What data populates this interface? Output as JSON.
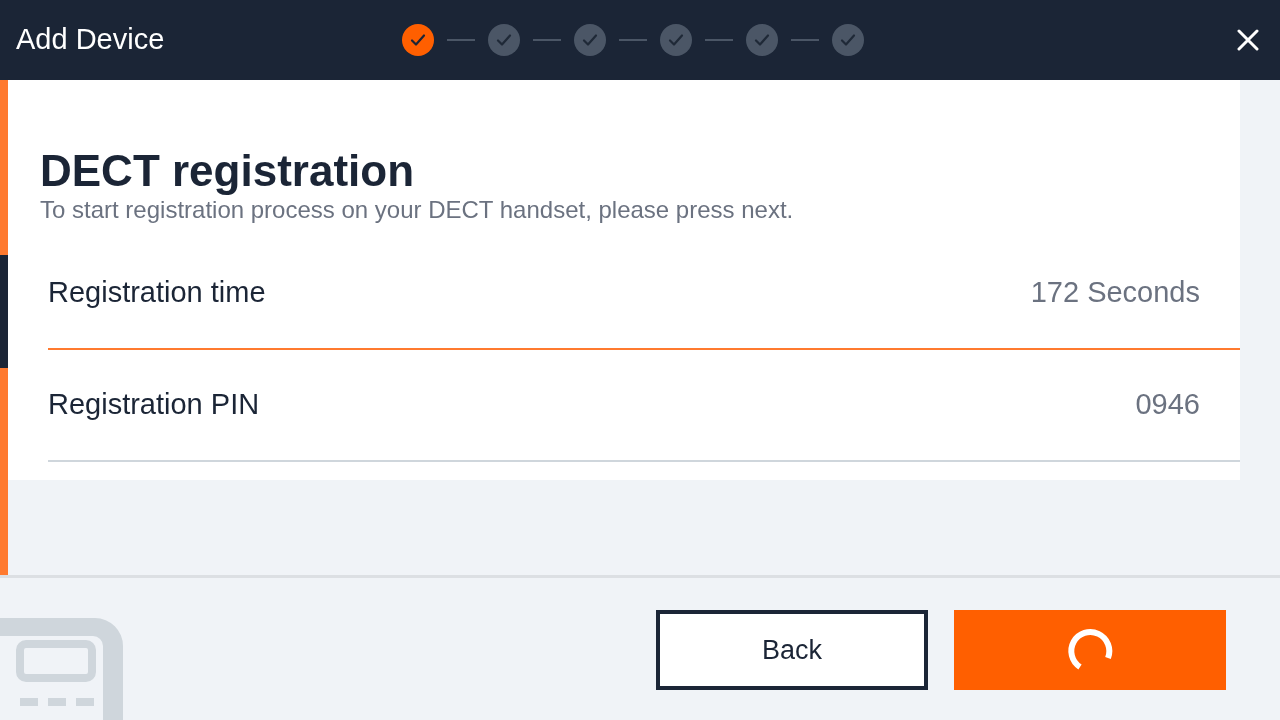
{
  "header": {
    "title": "Add Device",
    "steps": [
      {
        "selected": true
      },
      {
        "selected": false
      },
      {
        "selected": false
      },
      {
        "selected": false
      },
      {
        "selected": false
      },
      {
        "selected": false
      }
    ]
  },
  "page": {
    "title": "DECT registration",
    "description": "To start registration process on your DECT handset, please press next."
  },
  "rows": [
    {
      "label": "Registration time",
      "value": "172 Seconds",
      "selected": true
    },
    {
      "label": "Registration PIN",
      "value": "0946",
      "selected": false
    }
  ],
  "buttons": [
    {
      "kind": "secondary",
      "label": "Back"
    },
    {
      "kind": "loading"
    }
  ]
}
